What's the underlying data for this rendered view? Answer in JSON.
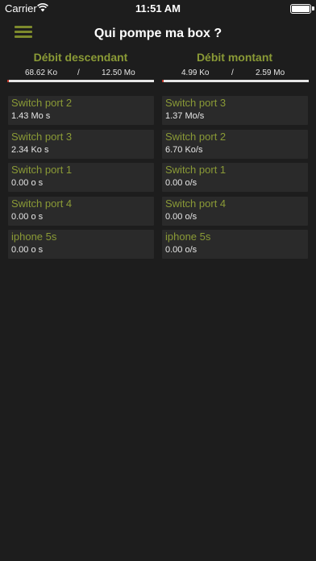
{
  "status_bar": {
    "carrier": "Carrier",
    "time": "11:51 AM"
  },
  "nav": {
    "title": "Qui pompe ma box ?",
    "menu_icon": "hamburger-menu-icon"
  },
  "colors": {
    "accent": "#8a9a36",
    "background": "#1d1d1d",
    "item_background": "#2a2a2a",
    "bar_fill": "#c0392b"
  },
  "download": {
    "header": "Débit descendant",
    "used": "68.62 Ko",
    "separator": "/",
    "total": "12.50 Mo",
    "fraction": 0.005
  },
  "upload": {
    "header": "Débit montant",
    "used": "4.99 Ko",
    "separator": "/",
    "total": "2.59 Mo",
    "fraction": 0.002
  },
  "download_items": [
    {
      "name": "Switch port 2",
      "rate": "1.43 Mo s"
    },
    {
      "name": "Switch port 3",
      "rate": "2.34 Ko s"
    },
    {
      "name": "Switch port 1",
      "rate": "0.00 o s"
    },
    {
      "name": "Switch port 4",
      "rate": "0.00 o s"
    },
    {
      "name": "iphone 5s",
      "rate": "0.00 o s"
    }
  ],
  "upload_items": [
    {
      "name": "Switch port 3",
      "rate": "1.37 Mo/s"
    },
    {
      "name": "Switch port 2",
      "rate": "6.70 Ko/s"
    },
    {
      "name": "Switch port 1",
      "rate": "0.00 o/s"
    },
    {
      "name": "Switch port 4",
      "rate": "0.00 o/s"
    },
    {
      "name": "iphone 5s",
      "rate": "0.00 o/s"
    }
  ]
}
